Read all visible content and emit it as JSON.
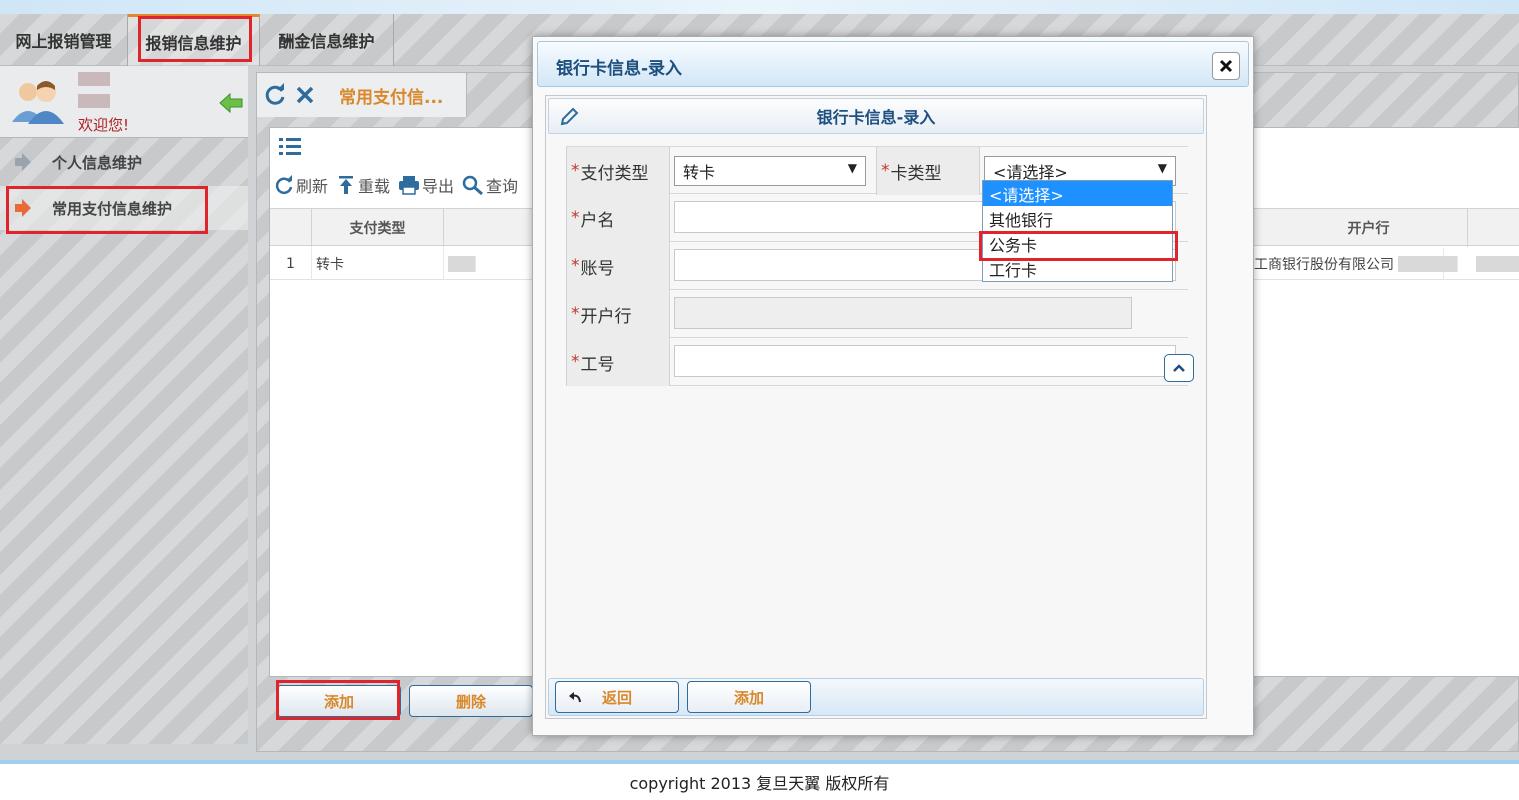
{
  "nav": {
    "tabs": [
      {
        "label": "网上报销管理"
      },
      {
        "label": "报销信息维护"
      },
      {
        "label": "酬金信息维护"
      }
    ]
  },
  "sidebar": {
    "welcome": "欢迎您!",
    "items": [
      {
        "label": "个人信息维护"
      },
      {
        "label": "常用支付信息维护"
      }
    ]
  },
  "main": {
    "tab_title": "常用支付信...",
    "toolbar": {
      "refresh": "刷新",
      "reload": "重载",
      "export": "导出",
      "query": "查询"
    },
    "columns": {
      "pay_type": "支付类型",
      "bank": "开户行"
    },
    "rows": [
      {
        "index": "1",
        "pay_type": "转卡",
        "bank": "工商银行股份有限公司"
      }
    ],
    "buttons": {
      "add": "添加",
      "delete": "删除"
    }
  },
  "dialog": {
    "title": "银行卡信息-录入",
    "inner_title": "银行卡信息-录入",
    "form": {
      "required_mark": "*",
      "pay_type_label": "支付类型",
      "pay_type_value": "转卡",
      "card_type_label": "卡类型",
      "card_type_value": "<请选择>",
      "account_name_label": "户名",
      "account_no_label": "账号",
      "bank_label": "开户行",
      "employee_no_label": "工号"
    },
    "card_type_options": [
      "<请选择>",
      "其他银行",
      "公务卡",
      "工行卡"
    ],
    "buttons": {
      "back": "返回",
      "add": "添加"
    }
  },
  "footer": {
    "copyright": "copyright 2013 复旦天翼 版权所有"
  },
  "colors": {
    "accent_orange": "#d9882b",
    "title_blue": "#1d4f80",
    "highlight_red": "#e0242b",
    "selected_blue": "#1e90ff"
  }
}
